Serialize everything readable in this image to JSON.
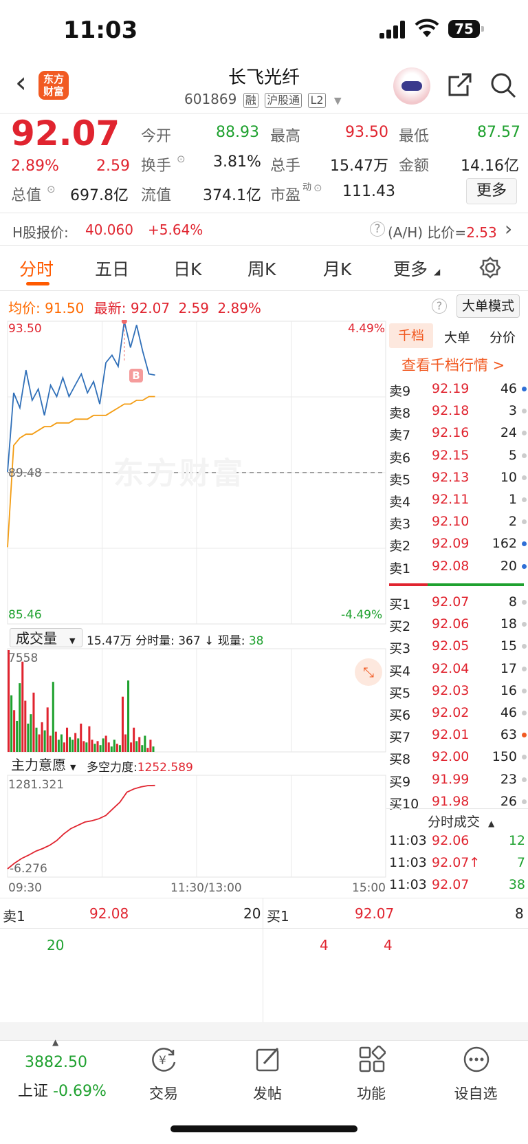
{
  "status": {
    "time": "11:03",
    "battery": "75"
  },
  "header": {
    "logo_text": "东方\n财富",
    "stock_name": "长飞光纤",
    "stock_code": "601869",
    "tags": [
      "融",
      "沪股通",
      "L2"
    ]
  },
  "quote": {
    "price": "92.07",
    "change_pct": "2.89%",
    "change": "2.59",
    "open_label": "今开",
    "open": "88.93",
    "high_label": "最高",
    "high": "93.50",
    "low_label": "最低",
    "low": "87.57",
    "turnover_label": "换手",
    "turnover": "3.81%",
    "volume_label": "总手",
    "volume": "15.47万",
    "amount_label": "金额",
    "amount": "14.16亿",
    "mcap_label": "总值",
    "mcap": "697.8亿",
    "float_label": "流值",
    "float": "374.1亿",
    "pe_label": "市盈",
    "pe_sup": "动",
    "pe": "111.43",
    "more": "更多"
  },
  "hshare": {
    "label": "H股报价:",
    "price": "40.060",
    "pct": "+5.64%",
    "ah_label": "(A/H) 比价=",
    "ah": "2.53"
  },
  "tabs": [
    "分时",
    "五日",
    "日K",
    "周K",
    "月K",
    "更多"
  ],
  "info_line": {
    "avg_label": "均价:",
    "avg": "91.50",
    "last_label": "最新:",
    "last": "92.07",
    "chg": "2.59",
    "pct": "2.89%",
    "mode_btn": "大单模式"
  },
  "chart": {
    "y_top": "93.50",
    "y_mid": "89.48",
    "y_bot": "85.46",
    "pct_top": "4.49%",
    "pct_bot": "-4.49%",
    "watermark": "东方财富",
    "marker": "B",
    "vol_selector": "成交量",
    "vol_info": "15.47万 分时量: 367 ↓ 现量:",
    "vol_now": "38",
    "vol_max": "7558",
    "ind_selector": "主力意愿",
    "ind_label": "多空力度:",
    "ind_value": "1252.589",
    "ind_top": "1281.321",
    "ind_bot": "-6.276",
    "t_start": "09:30",
    "t_mid": "11:30/13:00",
    "t_end": "15:00"
  },
  "chart_data": {
    "type": "line",
    "y_range": [
      85.46,
      93.5
    ],
    "series": [
      {
        "values": [
          89.5,
          91.6,
          91.2,
          92.2,
          91.4,
          91.7,
          91.0,
          91.8,
          91.5,
          92.0,
          91.5,
          91.8,
          92.1,
          91.6,
          91.9,
          91.3,
          92.4,
          92.6,
          92.3,
          93.5,
          92.8,
          93.4,
          92.7,
          92.1,
          92.07
        ]
      },
      {
        "values": [
          87.5,
          90.2,
          90.4,
          90.5,
          90.5,
          90.6,
          90.7,
          90.7,
          90.8,
          90.8,
          90.8,
          90.9,
          90.9,
          90.9,
          91.0,
          91.0,
          91.0,
          91.1,
          91.2,
          91.3,
          91.3,
          91.4,
          91.4,
          91.5,
          91.5
        ]
      }
    ],
    "volume": [
      7558,
      4200,
      3100,
      2300,
      5100,
      6700,
      3800,
      2100,
      2800,
      4400,
      1800,
      1300,
      2200,
      1600,
      3300,
      1200,
      5200,
      1500,
      900,
      1300,
      700,
      1800,
      1100,
      900,
      1400,
      1000,
      2100,
      800,
      700,
      1900,
      900,
      600,
      800,
      500,
      1000,
      1200,
      700,
      400,
      900,
      600,
      500,
      4100,
      1300,
      5300,
      700,
      1800,
      800,
      1100,
      500,
      1200,
      300,
      900,
      400
    ],
    "strength": [
      -6.276,
      80,
      150,
      200,
      260,
      300,
      350,
      420,
      520,
      600,
      650,
      700,
      720,
      750,
      800,
      900,
      1000,
      1150,
      1200,
      1230,
      1250,
      1252.589
    ]
  },
  "orderbook": {
    "tabs": [
      "千档",
      "大单",
      "分价"
    ],
    "link": "查看千档行情 >",
    "asks": [
      {
        "label": "卖9",
        "price": "92.19",
        "vol": "46",
        "dot": "#2f6fd6"
      },
      {
        "label": "卖8",
        "price": "92.18",
        "vol": "3",
        "dot": "#cccccc"
      },
      {
        "label": "卖7",
        "price": "92.16",
        "vol": "24",
        "dot": "#cccccc"
      },
      {
        "label": "卖6",
        "price": "92.15",
        "vol": "5",
        "dot": "#cccccc"
      },
      {
        "label": "卖5",
        "price": "92.13",
        "vol": "10",
        "dot": "#cccccc"
      },
      {
        "label": "卖4",
        "price": "92.11",
        "vol": "1",
        "dot": "#cccccc"
      },
      {
        "label": "卖3",
        "price": "92.10",
        "vol": "2",
        "dot": "#cccccc"
      },
      {
        "label": "卖2",
        "price": "92.09",
        "vol": "162",
        "dot": "#2f6fd6"
      },
      {
        "label": "卖1",
        "price": "92.08",
        "vol": "20",
        "dot": "#2f6fd6"
      }
    ],
    "bids": [
      {
        "label": "买1",
        "price": "92.07",
        "vol": "8",
        "dot": "#cccccc"
      },
      {
        "label": "买2",
        "price": "92.06",
        "vol": "18",
        "dot": "#cccccc"
      },
      {
        "label": "买3",
        "price": "92.05",
        "vol": "15",
        "dot": "#cccccc"
      },
      {
        "label": "买4",
        "price": "92.04",
        "vol": "17",
        "dot": "#cccccc"
      },
      {
        "label": "买5",
        "price": "92.03",
        "vol": "16",
        "dot": "#cccccc"
      },
      {
        "label": "买6",
        "price": "92.02",
        "vol": "46",
        "dot": "#cccccc"
      },
      {
        "label": "买7",
        "price": "92.01",
        "vol": "63",
        "dot": "#f15a22"
      },
      {
        "label": "买8",
        "price": "92.00",
        "vol": "150",
        "dot": "#cccccc"
      },
      {
        "label": "买9",
        "price": "91.99",
        "vol": "23",
        "dot": "#cccccc"
      },
      {
        "label": "买10",
        "price": "91.98",
        "vol": "26",
        "dot": "#cccccc"
      }
    ],
    "trades_title": "分时成交",
    "trades": [
      {
        "time": "11:03",
        "price": "92.06",
        "vol": "12"
      },
      {
        "time": "11:03",
        "price": "92.07↑",
        "vol": "7"
      },
      {
        "time": "11:03",
        "price": "92.07",
        "vol": "38"
      }
    ]
  },
  "queue": {
    "ask_label": "卖1",
    "ask_price": "92.08",
    "ask_vol": "20",
    "bid_label": "买1",
    "bid_price": "92.07",
    "bid_vol": "8",
    "ask_items": [
      "20"
    ],
    "bid_items": [
      "4",
      "4"
    ]
  },
  "bottom": {
    "index_value": "3882.50",
    "index_name": "上证",
    "index_pct": "-0.69%",
    "trade": "交易",
    "post": "发帖",
    "func": "功能",
    "watch": "设自选"
  }
}
